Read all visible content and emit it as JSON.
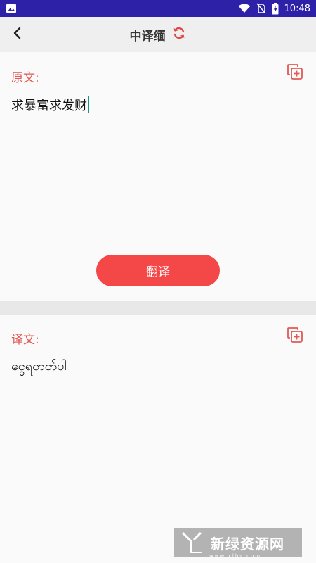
{
  "status_bar": {
    "time": "10:48",
    "background_color": "#2c21a7",
    "icons": [
      "image-notification-icon",
      "wifi-icon",
      "no-sim-icon",
      "battery-charging-icon"
    ]
  },
  "app_bar": {
    "title": "中译缅",
    "back_icon": "chevron-left-icon",
    "swap_icon": "refresh-icon"
  },
  "source": {
    "label": "原文:",
    "text": "求暴富求发财",
    "copy_icon": "copy-add-icon"
  },
  "translate_button": {
    "label": "翻译",
    "color": "#f44848"
  },
  "target": {
    "label": "译文:",
    "text": "ငွေရတတ်ပါ",
    "copy_icon": "copy-add-icon"
  },
  "watermark": {
    "text": "新绿资源网",
    "url": "www.xlhs.com"
  },
  "colors": {
    "accent": "#e05a55",
    "divider": "#e8e8e8"
  }
}
